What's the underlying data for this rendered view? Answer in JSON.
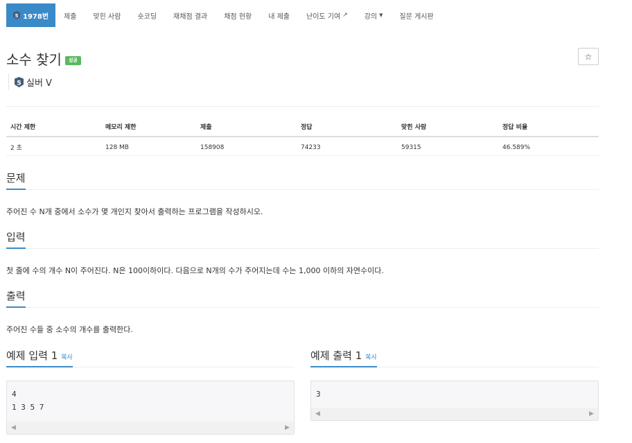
{
  "nav": {
    "problem_id": "1978번",
    "items": [
      "제출",
      "맞힌 사람",
      "숏코딩",
      "재채점 결과",
      "채점 현황",
      "내 제출",
      "난이도 기여",
      "강의",
      "질문 게시판"
    ]
  },
  "problem": {
    "title": "소수 찾기",
    "status_badge": "성공",
    "tier_number": "5",
    "tier_label": "실버 V",
    "star_glyph": "☆"
  },
  "info_table": {
    "headers": [
      "시간 제한",
      "메모리 제한",
      "제출",
      "정답",
      "맞힌 사람",
      "정답 비율"
    ],
    "values": [
      "2 초",
      "128 MB",
      "158908",
      "74233",
      "59315",
      "46.589%"
    ]
  },
  "sections": {
    "problem_title": "문제",
    "problem_text": "주어진 수 N개 중에서 소수가 몇 개인지 찾아서 출력하는 프로그램을 작성하시오.",
    "input_title": "입력",
    "input_text": "첫 줄에 수의 개수 N이 주어진다. N은 100이하이다. 다음으로 N개의 수가 주어지는데 수는 1,000 이하의 자연수이다.",
    "output_title": "출력",
    "output_text": "주어진 수들 중 소수의 개수를 출력한다."
  },
  "samples": {
    "input_title": "예제 입력 1",
    "output_title": "예제 출력 1",
    "copy_label": "복사",
    "input_value": "4\n1 3 5 7",
    "output_value": "3"
  },
  "colors": {
    "nav_active": "#3a8ac8",
    "success": "#5cb85c",
    "tier_silver": "#435f7a"
  },
  "icons": {
    "external_link": "external-link-icon",
    "caret": "caret-down-icon",
    "star": "star-icon",
    "tier": "silver-tier-icon"
  }
}
